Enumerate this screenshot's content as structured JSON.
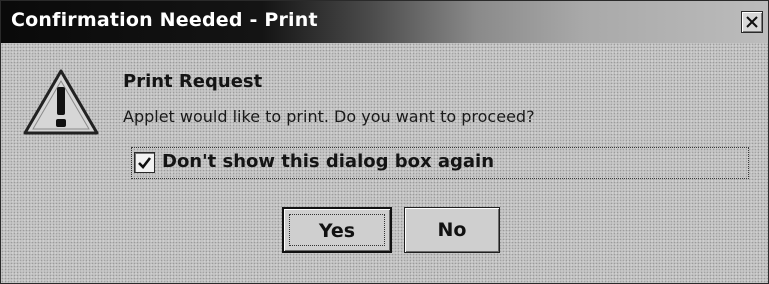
{
  "window": {
    "title": "Confirmation Needed - Print",
    "close_icon": "close-icon"
  },
  "content": {
    "icon": "warning-icon",
    "heading": "Print Request",
    "message": "Applet would like to print. Do you want to proceed?"
  },
  "checkbox": {
    "label": "Don't show this dialog box again",
    "checked": true
  },
  "buttons": {
    "yes_label": "Yes",
    "no_label": "No",
    "default": "Yes"
  },
  "colors": {
    "dialog_background": "#c6c6c6",
    "titlebar_dark": "#0a0a0a",
    "titlebar_light": "#bcbcbc",
    "title_text": "#ffffff"
  }
}
